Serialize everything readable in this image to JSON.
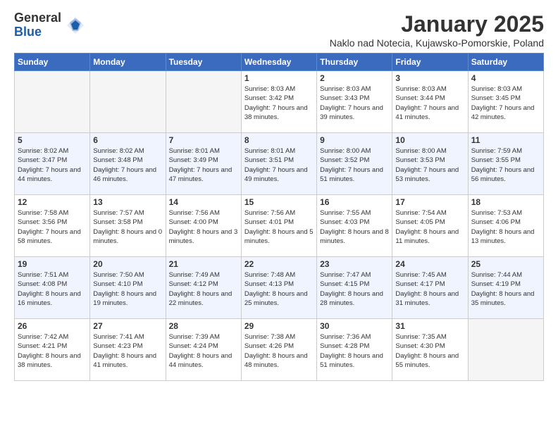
{
  "logo": {
    "general": "General",
    "blue": "Blue"
  },
  "title": "January 2025",
  "subtitle": "Naklo nad Notecia, Kujawsko-Pomorskie, Poland",
  "days_of_week": [
    "Sunday",
    "Monday",
    "Tuesday",
    "Wednesday",
    "Thursday",
    "Friday",
    "Saturday"
  ],
  "weeks": [
    [
      {
        "day": "",
        "info": ""
      },
      {
        "day": "",
        "info": ""
      },
      {
        "day": "",
        "info": ""
      },
      {
        "day": "1",
        "info": "Sunrise: 8:03 AM\nSunset: 3:42 PM\nDaylight: 7 hours and 38 minutes."
      },
      {
        "day": "2",
        "info": "Sunrise: 8:03 AM\nSunset: 3:43 PM\nDaylight: 7 hours and 39 minutes."
      },
      {
        "day": "3",
        "info": "Sunrise: 8:03 AM\nSunset: 3:44 PM\nDaylight: 7 hours and 41 minutes."
      },
      {
        "day": "4",
        "info": "Sunrise: 8:03 AM\nSunset: 3:45 PM\nDaylight: 7 hours and 42 minutes."
      }
    ],
    [
      {
        "day": "5",
        "info": "Sunrise: 8:02 AM\nSunset: 3:47 PM\nDaylight: 7 hours and 44 minutes."
      },
      {
        "day": "6",
        "info": "Sunrise: 8:02 AM\nSunset: 3:48 PM\nDaylight: 7 hours and 46 minutes."
      },
      {
        "day": "7",
        "info": "Sunrise: 8:01 AM\nSunset: 3:49 PM\nDaylight: 7 hours and 47 minutes."
      },
      {
        "day": "8",
        "info": "Sunrise: 8:01 AM\nSunset: 3:51 PM\nDaylight: 7 hours and 49 minutes."
      },
      {
        "day": "9",
        "info": "Sunrise: 8:00 AM\nSunset: 3:52 PM\nDaylight: 7 hours and 51 minutes."
      },
      {
        "day": "10",
        "info": "Sunrise: 8:00 AM\nSunset: 3:53 PM\nDaylight: 7 hours and 53 minutes."
      },
      {
        "day": "11",
        "info": "Sunrise: 7:59 AM\nSunset: 3:55 PM\nDaylight: 7 hours and 56 minutes."
      }
    ],
    [
      {
        "day": "12",
        "info": "Sunrise: 7:58 AM\nSunset: 3:56 PM\nDaylight: 7 hours and 58 minutes."
      },
      {
        "day": "13",
        "info": "Sunrise: 7:57 AM\nSunset: 3:58 PM\nDaylight: 8 hours and 0 minutes."
      },
      {
        "day": "14",
        "info": "Sunrise: 7:56 AM\nSunset: 4:00 PM\nDaylight: 8 hours and 3 minutes."
      },
      {
        "day": "15",
        "info": "Sunrise: 7:56 AM\nSunset: 4:01 PM\nDaylight: 8 hours and 5 minutes."
      },
      {
        "day": "16",
        "info": "Sunrise: 7:55 AM\nSunset: 4:03 PM\nDaylight: 8 hours and 8 minutes."
      },
      {
        "day": "17",
        "info": "Sunrise: 7:54 AM\nSunset: 4:05 PM\nDaylight: 8 hours and 11 minutes."
      },
      {
        "day": "18",
        "info": "Sunrise: 7:53 AM\nSunset: 4:06 PM\nDaylight: 8 hours and 13 minutes."
      }
    ],
    [
      {
        "day": "19",
        "info": "Sunrise: 7:51 AM\nSunset: 4:08 PM\nDaylight: 8 hours and 16 minutes."
      },
      {
        "day": "20",
        "info": "Sunrise: 7:50 AM\nSunset: 4:10 PM\nDaylight: 8 hours and 19 minutes."
      },
      {
        "day": "21",
        "info": "Sunrise: 7:49 AM\nSunset: 4:12 PM\nDaylight: 8 hours and 22 minutes."
      },
      {
        "day": "22",
        "info": "Sunrise: 7:48 AM\nSunset: 4:13 PM\nDaylight: 8 hours and 25 minutes."
      },
      {
        "day": "23",
        "info": "Sunrise: 7:47 AM\nSunset: 4:15 PM\nDaylight: 8 hours and 28 minutes."
      },
      {
        "day": "24",
        "info": "Sunrise: 7:45 AM\nSunset: 4:17 PM\nDaylight: 8 hours and 31 minutes."
      },
      {
        "day": "25",
        "info": "Sunrise: 7:44 AM\nSunset: 4:19 PM\nDaylight: 8 hours and 35 minutes."
      }
    ],
    [
      {
        "day": "26",
        "info": "Sunrise: 7:42 AM\nSunset: 4:21 PM\nDaylight: 8 hours and 38 minutes."
      },
      {
        "day": "27",
        "info": "Sunrise: 7:41 AM\nSunset: 4:23 PM\nDaylight: 8 hours and 41 minutes."
      },
      {
        "day": "28",
        "info": "Sunrise: 7:39 AM\nSunset: 4:24 PM\nDaylight: 8 hours and 44 minutes."
      },
      {
        "day": "29",
        "info": "Sunrise: 7:38 AM\nSunset: 4:26 PM\nDaylight: 8 hours and 48 minutes."
      },
      {
        "day": "30",
        "info": "Sunrise: 7:36 AM\nSunset: 4:28 PM\nDaylight: 8 hours and 51 minutes."
      },
      {
        "day": "31",
        "info": "Sunrise: 7:35 AM\nSunset: 4:30 PM\nDaylight: 8 hours and 55 minutes."
      },
      {
        "day": "",
        "info": ""
      }
    ]
  ]
}
